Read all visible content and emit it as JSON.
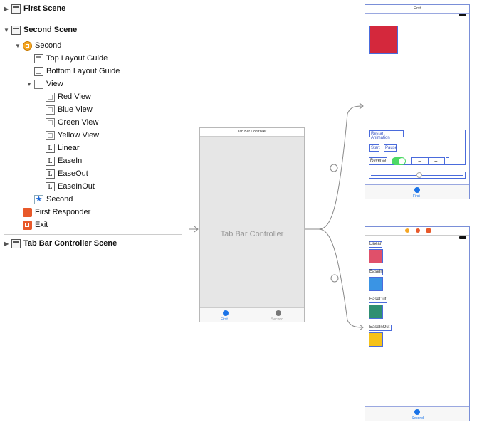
{
  "outline": {
    "first_scene": "First Scene",
    "second_scene": "Second Scene",
    "second": "Second",
    "top_layout_guide": "Top Layout Guide",
    "bottom_layout_guide": "Bottom Layout Guide",
    "view": "View",
    "red_view": "Red View",
    "blue_view": "Blue View",
    "green_view": "Green View",
    "yellow_view": "Yellow View",
    "linear": "Linear",
    "easein": "EaseIn",
    "easeout": "EaseOut",
    "easeinout": "EaseInOut",
    "second_tab_item": "Second",
    "first_responder": "First Responder",
    "exit": "Exit",
    "tab_bar_controller_scene": "Tab Bar Controller Scene",
    "label_glyph": "L",
    "tab_glyph": "★"
  },
  "canvas": {
    "tbc_header": "Tab Bar Controller",
    "tbc_title": "Tab Bar Controller",
    "tbc_tab_first": "First",
    "tbc_tab_second": "Second",
    "first_header": "First",
    "first_restart_label": "Restart Animation",
    "first_start_label": "Start",
    "first_pause_label": "Pause",
    "first_reverse_label": "Reverse",
    "first_stepper_minus": "−",
    "first_stepper_plus": "+",
    "first_tab_label": "First",
    "second_linear": "Linear",
    "second_easein": "EaseIn",
    "second_easeout": "EaseOut",
    "second_easeinout": "EaseInOut",
    "second_tab_label": "Second"
  },
  "colors": {
    "red": "#d4283c",
    "pink": "#e0506a",
    "blue": "#3a94e4",
    "green": "#2f8f72",
    "yellow": "#f5c21a",
    "selection": "#4a6bdc",
    "tab_blue": "#1a73e8",
    "switch_green": "#4cd964"
  }
}
